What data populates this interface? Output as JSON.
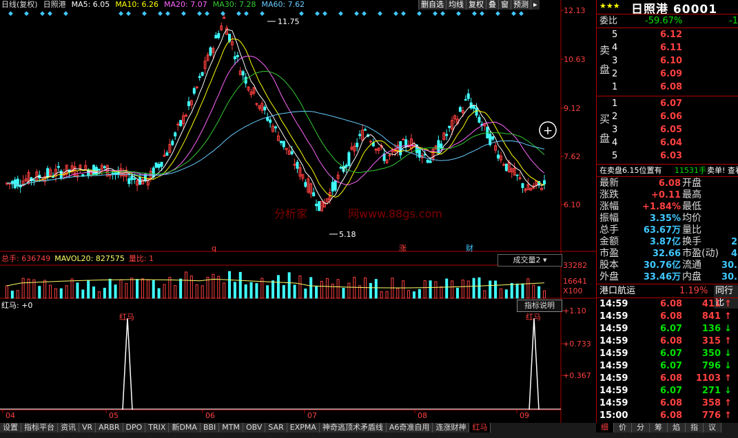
{
  "colors": {
    "up": "#ff4040",
    "down": "#40ffff",
    "ma5": "#ffffff",
    "ma10": "#ffff00",
    "ma20": "#ff66ff",
    "ma30": "#33cc33",
    "ma60": "#66ccff",
    "grid": "#b00000",
    "volma": "#ffff66"
  },
  "toolbar": {
    "title": "日线(复权)",
    "stock": "日照港",
    "ma5": "MA5: 6.05",
    "ma10": "MA10: 6.26",
    "ma20": "MA20: 7.07",
    "ma30": "MA30: 7.28",
    "ma60": "MA60: 7.62",
    "buttons": [
      "删自选",
      "均线",
      "复权",
      "叠",
      "窗",
      "预测"
    ],
    "scroll_icon": "arrow-right-icon"
  },
  "price_axis": [
    "12.13",
    "10.63",
    "9.12",
    "7.62",
    "6.10"
  ],
  "annotations": {
    "high": "11.75",
    "low": "5.18",
    "watermark": "分析家",
    "watermark2": "网www.88gs.com",
    "mark_q": "q",
    "mark_zhang": "涨",
    "mark_cai": "财",
    "mark_t": "T",
    "zoom_icon": "plus-circle-icon"
  },
  "volume": {
    "total": "总手: 636749",
    "mavol": "MAVOL20: 827575",
    "ratio": "量比: 1",
    "dropdown": "成交量2",
    "axis": [
      "33282",
      "16641",
      "X100"
    ]
  },
  "indicator": {
    "legend": "红马: +0",
    "help": "指标说明",
    "axis": [
      "+1.10",
      "+0.733",
      "+0.367"
    ],
    "peak_label": "红马"
  },
  "x_axis": [
    "04",
    "05",
    "06",
    "07",
    "08",
    "09"
  ],
  "bottom_tabs": [
    "设置",
    "指标平台",
    "资讯",
    "VR",
    "ARBR",
    "DPO",
    "TRIX",
    "新DMA",
    "BBI",
    "MTM",
    "OBV",
    "SAR",
    "EXPMA",
    "神奇逃顶术矛盾线",
    "A6奇准自用",
    "连涨财神",
    "红马"
  ],
  "right_bottom_tabs": [
    "细",
    "价",
    "分",
    "筹",
    "焰",
    "指",
    "议"
  ],
  "quote": {
    "header": "日照港 60001",
    "weibi_label": "委比",
    "weibi": "-59.67%",
    "weibi2": "-1",
    "sell_label": [
      "卖",
      "盘"
    ],
    "buy_label": [
      "买",
      "盘"
    ],
    "sells": [
      {
        "n": "5",
        "p": "6.12"
      },
      {
        "n": "4",
        "p": "6.11"
      },
      {
        "n": "3",
        "p": "6.10"
      },
      {
        "n": "2",
        "p": "6.09"
      },
      {
        "n": "1",
        "p": "6.08"
      }
    ],
    "buys": [
      {
        "n": "1",
        "p": "6.07"
      },
      {
        "n": "2",
        "p": "6.06"
      },
      {
        "n": "3",
        "p": "6.05"
      },
      {
        "n": "4",
        "p": "6.04"
      },
      {
        "n": "5",
        "p": "6.03"
      }
    ],
    "notice": "在卖盘6.15位置有",
    "notice_vol": "11531手",
    "notice_tail": "卖单! 查看",
    "stats": [
      {
        "l": "最新",
        "v": "6.08",
        "l2": "开盘"
      },
      {
        "l": "涨跌",
        "v": "+0.11",
        "l2": "最高"
      },
      {
        "l": "涨幅",
        "v": "+1.84%",
        "l2": "最低"
      },
      {
        "l": "振幅",
        "v": "3.35%",
        "l2": "均价"
      },
      {
        "l": "总手",
        "v": "63.67万",
        "l2": "量比"
      },
      {
        "l": "金额",
        "v": "3.87亿",
        "l2": "换手",
        "v2": "2"
      },
      {
        "l": "市盈",
        "v": "32.66",
        "l2": "市盈(动)",
        "v2": "4"
      },
      {
        "l": "股本",
        "v": "30.76亿",
        "l2": "流通",
        "v2": "30."
      },
      {
        "l": "外盘",
        "v": "33.46万",
        "l2": "内盘",
        "v2": "30."
      }
    ],
    "industry": "港口航运",
    "industry_pct": "1.19%",
    "industry_btn": "同行比",
    "ticks": [
      {
        "t": "14:59",
        "p": "6.08",
        "v": "411",
        "d": "up"
      },
      {
        "t": "14:59",
        "p": "6.08",
        "v": "841",
        "d": "up"
      },
      {
        "t": "14:59",
        "p": "6.07",
        "v": "136",
        "d": "down"
      },
      {
        "t": "14:59",
        "p": "6.08",
        "v": "315",
        "d": "up"
      },
      {
        "t": "14:59",
        "p": "6.07",
        "v": "350",
        "d": "down"
      },
      {
        "t": "14:59",
        "p": "6.07",
        "v": "796",
        "d": "down"
      },
      {
        "t": "14:59",
        "p": "6.08",
        "v": "1103",
        "d": "up"
      },
      {
        "t": "14:59",
        "p": "6.07",
        "v": "271",
        "d": "down"
      },
      {
        "t": "14:59",
        "p": "6.08",
        "v": "358",
        "d": "up"
      },
      {
        "t": "15:00",
        "p": "6.08",
        "v": "776",
        "d": "up"
      }
    ]
  }
}
